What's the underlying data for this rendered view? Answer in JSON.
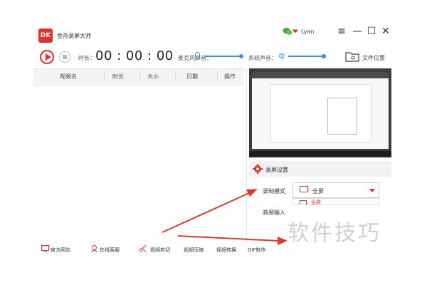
{
  "app": {
    "title": "金舟录屏大师",
    "logo_text": "DK"
  },
  "user": {
    "name": "Lyan"
  },
  "window": {
    "menu": "≡",
    "minimize": "—",
    "maximize": "☐",
    "close": "✕"
  },
  "toolbar": {
    "duration_label": "时长：",
    "timer": "00 : 00 : 00",
    "mic_label": "麦克风声音：",
    "system_label": "系统声音：",
    "file_location": "文件位置"
  },
  "table": {
    "columns": [
      "视频名",
      "时长",
      "大小",
      "日期",
      "操作"
    ]
  },
  "settings": {
    "title": "录屏设置",
    "record_mode_label": "录制模式",
    "record_mode_value": "全屏",
    "dropdown_option": "全屏",
    "audio_input_label": "音频输入"
  },
  "footer": {
    "items": [
      "官方网站",
      "在线客服",
      "视频剪切",
      "视频压缩",
      "视频转换",
      "GIF制作"
    ]
  },
  "watermark": "软件技巧",
  "colors": {
    "accent": "#e0322b",
    "slider": "#3a8ee6",
    "arrow": "#e23a2a"
  }
}
